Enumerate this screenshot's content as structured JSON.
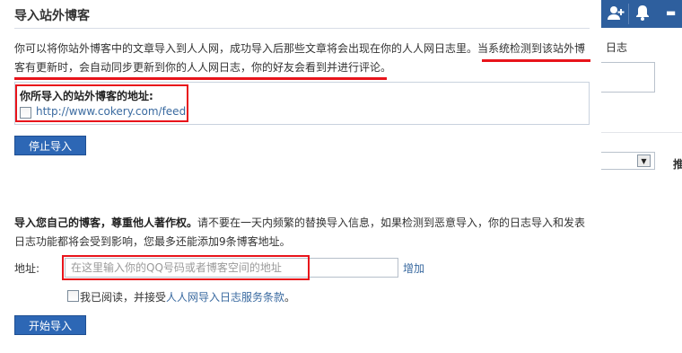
{
  "header": {
    "title": "导入站外博客"
  },
  "intro": {
    "text_part1": "你可以将你站外博客中的文章导入到人人网，成功导入后那些文章将会出现在你的人人网日志里。当系统检测到该站外博",
    "text_part2": "客有更新时，会自动同步更新到你的人人网日志，你的好友会看到并进行评论。"
  },
  "current_feed": {
    "label": "你所导入的站外博客的地址:",
    "url": "http://www.cokery.com/feed"
  },
  "stop_button": {
    "label": "停止导入"
  },
  "own_blog": {
    "heading": "导入您自己的博客，尊重他人著作权。",
    "description_rest": "请不要在一天内频繁的替换导入信息，如果检测到恶意导入，你的日志导入和发表日志功能都将会受到影响，您最多还能添加9条博客地址。"
  },
  "form": {
    "address_label": "地址:",
    "address_placeholder": "在这里输入你的QQ号码或者博客空间的地址",
    "add_link": "增加",
    "agree_prefix": "我已阅读，并接受",
    "terms_link": "人人网导入日志服务条款",
    "agree_suffix": "。"
  },
  "start_button": {
    "label": "开始导入"
  },
  "right_panel": {
    "fragment_text": "日志",
    "side_text": "推"
  },
  "colors": {
    "highlight": "#e8141b",
    "button": "#2d67b5",
    "link": "#3a6aa0",
    "nav": "#2e5f9e"
  }
}
